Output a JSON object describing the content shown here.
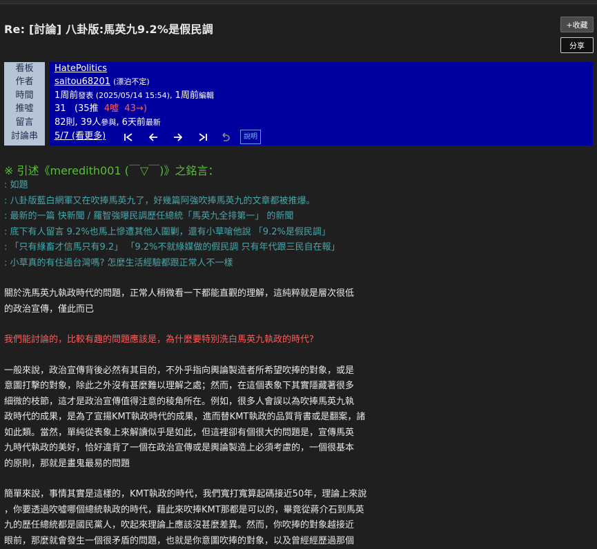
{
  "header": {
    "title": "Re: [討論] 八卦版:馬英九9.2%是假民調",
    "favorite_label": "+收藏",
    "share_label": "分享"
  },
  "meta": {
    "labels": [
      "看板",
      "作者",
      "時間",
      "推噓",
      "留言",
      "討論串"
    ],
    "board": "HatePolitics",
    "author_id": "saitou68201",
    "author_nick": "(漂泊不定)",
    "time_a": "1周前",
    "time_b": "發表 (2025/05/14 15:54),",
    "time_c": "1周前",
    "time_d": "編輯",
    "score": "31",
    "push_open": "(35推",
    "boo": "4噓",
    "arrow": "43→)",
    "comments_a": "82則, 39人",
    "comments_b": "參與",
    "comments_c": ", 6天前",
    "comments_d": "最新",
    "thread_pos": "5/7 (看更多)",
    "nav_icons": [
      "first-icon",
      "prev-icon",
      "next-icon",
      "last-icon",
      "undo-icon"
    ],
    "help_label": "說明"
  },
  "quote": {
    "header": "※ 引述《meredith001 (￣▽￣)》之銘言：",
    "lines": [
      ": 如題",
      ": 八卦版藍白網軍又在吹捧馬英九了，好幾篇阿強吹捧馬英九的文章都被推爆。",
      ": 最新的一篇 快新聞 / 羅智強曝民調歷任總統「馬英九全排第一」 的新聞",
      ": 底下有人留言 9.2%也馬上慘遭其他人圍剿，還有小草嗆他說 「9.2%是假民調」",
      ": 「只有綠畜才信馬只有9.2」 「9.2%不就綠媒做的假民調 只有年代跟三民自在報」",
      ": 小草真的有住過台灣嗎? 怎麼生活經驗都跟正常人不一樣"
    ]
  },
  "body": {
    "para1": [
      "關於洗馬英九執政時代的問題，正常人稍微看一下都能直觀的理解，這純粹就是層次很低",
      "的政治宣傳，僅此而已"
    ],
    "highlight": "我們能討論的，比較有趣的問題應該是，為什麼要特別洗白馬英九執政的時代?",
    "para2": [
      "一般來說，政治宣傳背後必然有其目的，不外乎指向輿論製造者所希望吹捧的對象，或是",
      "意圖打擊的對象，除此之外沒有甚麼難以理解之處；然而，在這個表象下其實隱藏著很多",
      "細微的枝節，這才是政治宣傳值得注意的稜角所在。例如，很多人會誤以為吹捧馬英九執",
      "政時代的成果，是為了宣揚KMT執政時代的成果，進而替KMT執政的品質背書或是翻案，諸",
      "如此類。當然，單純從表象上來解讀似乎是如此，但這裡卻有個很大的問題是，宣傳馬英",
      "九時代執政的美好，恰好違背了一個在政治宣傳或是輿論製造上必須考慮的，一個很基本",
      "的原則，那就是畫鬼最易的問題"
    ],
    "para3": [
      "簡單來說，事情其實是這樣的，KMT執政的時代，我們寬打寬算起碼接近50年，理論上來說",
      "，你要透過吹噓哪個總統執政的時代，藉此來吹捧KMT那都是可以的，畢竟從蔣介石到馬英",
      "九的歷任總統都是國民黨人，吹起來理論上應該沒甚麼差異。然而，你吹捧的對象越接近",
      "眼前，那麼就會發生一個很矛盾的問題，也就是你意圖吹捧的對象，以及曾經經歷過那個"
    ]
  }
}
